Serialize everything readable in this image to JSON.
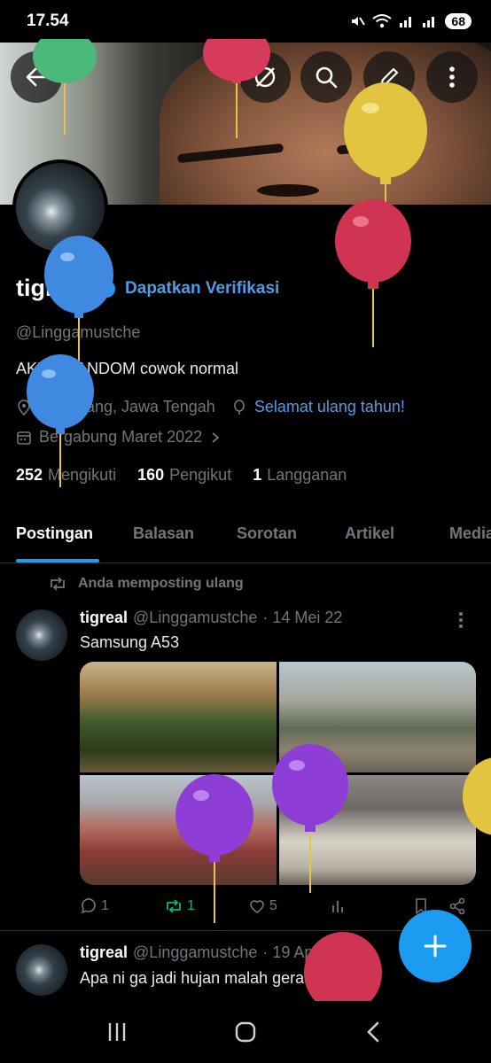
{
  "status_bar": {
    "time": "17.54",
    "battery": "68"
  },
  "profile": {
    "name": "tigreal",
    "verify_link": "Dapatkan Verifikasi",
    "handle": "@Linggamustche",
    "bio": "AKUN RANDOM  cowok normal",
    "location": "Semarang, Jawa Tengah",
    "birthday_link": "Selamat ulang tahun!",
    "joined": "Bergabung Maret 2022",
    "following_count": "252",
    "following_label": "Mengikuti",
    "followers_count": "160",
    "followers_label": "Pengikut",
    "subs_count": "1",
    "subs_label": "Langganan"
  },
  "tabs": [
    {
      "label": "Postingan"
    },
    {
      "label": "Balasan"
    },
    {
      "label": "Sorotan"
    },
    {
      "label": "Artikel"
    },
    {
      "label": "Media"
    }
  ],
  "posts": [
    {
      "repost_note": "Anda memposting ulang",
      "name": "tigreal",
      "handle": "@Linggamustche",
      "time": "· 14 Mei 22",
      "text": "Samsung A53",
      "replies": "1",
      "reposts": "1",
      "likes": "5"
    },
    {
      "name": "tigreal",
      "handle": "@Linggamustche",
      "time": "· 19 Apr",
      "text": "Apa ni ga jadi hujan malah gerah"
    }
  ],
  "colors": {
    "accent": "#1d9bf0",
    "link": "#4c9ee8",
    "repost_green": "#00ba7c",
    "muted": "#71767b"
  },
  "icons": [
    "back-arrow-icon",
    "grok-icon",
    "search-icon",
    "edit-icon",
    "more-icon",
    "verified-badge-icon",
    "location-icon",
    "balloon-icon",
    "calendar-icon",
    "chevron-right-icon",
    "repost-icon",
    "reply-icon",
    "like-icon",
    "views-icon",
    "bookmark-icon",
    "share-icon",
    "plus-icon"
  ]
}
